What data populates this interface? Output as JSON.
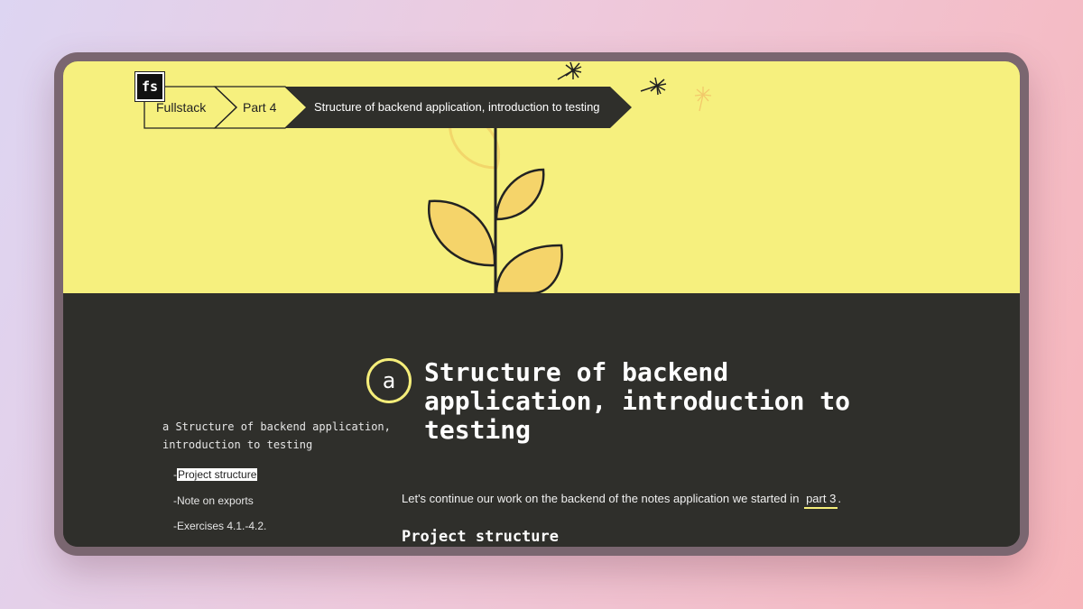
{
  "breadcrumb": {
    "logo": "fs",
    "items": [
      "Fullstack",
      "Part 4",
      "Structure of backend application, introduction to testing"
    ]
  },
  "hero": {
    "background": "#f6f07e"
  },
  "article": {
    "letter": "a",
    "title": "Structure of backend application, introduction to testing",
    "intro_text": "Let's continue our work on the backend of the notes application we started in",
    "intro_link": "part 3",
    "intro_end": ".",
    "section_heading": "Project structure"
  },
  "toc": {
    "heading": "a Structure of backend application, introduction to testing",
    "items": [
      {
        "prefix": "-",
        "label": "Project structure",
        "active": true
      },
      {
        "prefix": "-",
        "label": "Note on exports",
        "active": false
      },
      {
        "prefix": "-",
        "label": "Exercises 4.1.-4.2.",
        "active": false
      }
    ]
  },
  "colors": {
    "accent": "#f5ee7a",
    "dark": "#2f2f2b",
    "leaf": "#f5d46a"
  }
}
